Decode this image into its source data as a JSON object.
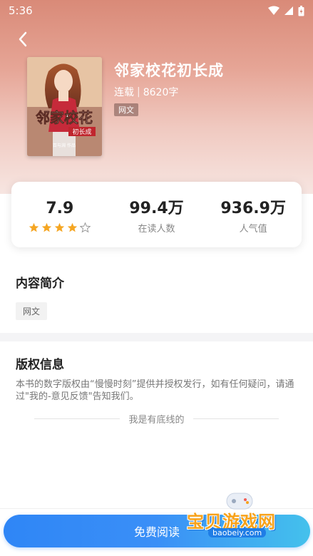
{
  "status_bar": {
    "time": "5:36"
  },
  "book": {
    "title": "邻家校花初长成",
    "status": "连载",
    "separator": "|",
    "word_count": "8620字",
    "genre_tag": "网文"
  },
  "cover": {
    "title_text": "邻家校花",
    "sub_text": "初长成",
    "author_text": "百与淵 作品"
  },
  "stats": {
    "rating": "7.9",
    "rating_stars": 4,
    "rating_max": 5,
    "readers_value": "99.4万",
    "readers_label": "在读人数",
    "popularity_value": "936.9万",
    "popularity_label": "人气值"
  },
  "intro": {
    "title": "内容简介",
    "tag": "网文"
  },
  "copyright": {
    "title": "版权信息",
    "text": "本书的数字版权由“慢慢时刻”提供并授权发行，如有任何疑问，请通过\"我的-意见反馈\"告知我们。",
    "end_line": "我是有底线的"
  },
  "actions": {
    "read_label": "免费阅读"
  },
  "watermark": {
    "name": "宝贝游戏网",
    "url": "baobeiy.com"
  },
  "colors": {
    "accent": "#2f86f6",
    "star": "#f5a623"
  }
}
